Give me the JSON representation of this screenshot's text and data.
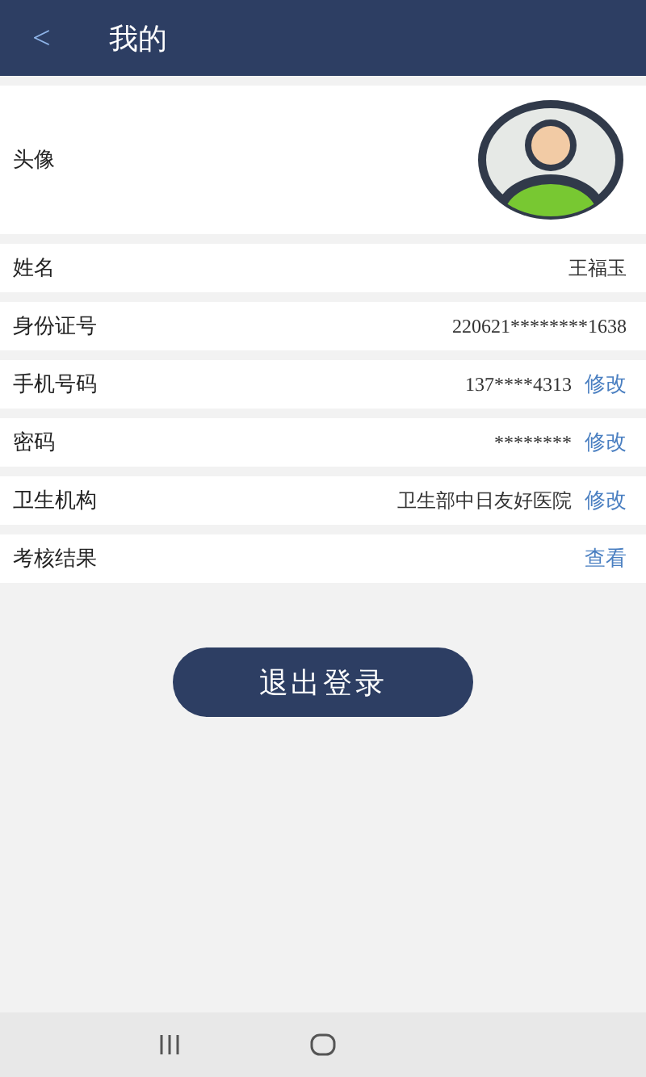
{
  "header": {
    "back": "<",
    "title": "我的"
  },
  "avatar_row": {
    "label": "头像"
  },
  "rows": [
    {
      "label": "姓名",
      "value": "王福玉"
    },
    {
      "label": "身份证号",
      "value": "220621********1638"
    },
    {
      "label": "手机号码",
      "value": "137****4313",
      "action": "修改"
    },
    {
      "label": "密码",
      "value": "********",
      "action": "修改"
    },
    {
      "label": "卫生机构",
      "value": "卫生部中日友好医院",
      "action": "修改"
    },
    {
      "label": "考核结果",
      "action": "查看"
    }
  ],
  "logout_button": "退出登录"
}
